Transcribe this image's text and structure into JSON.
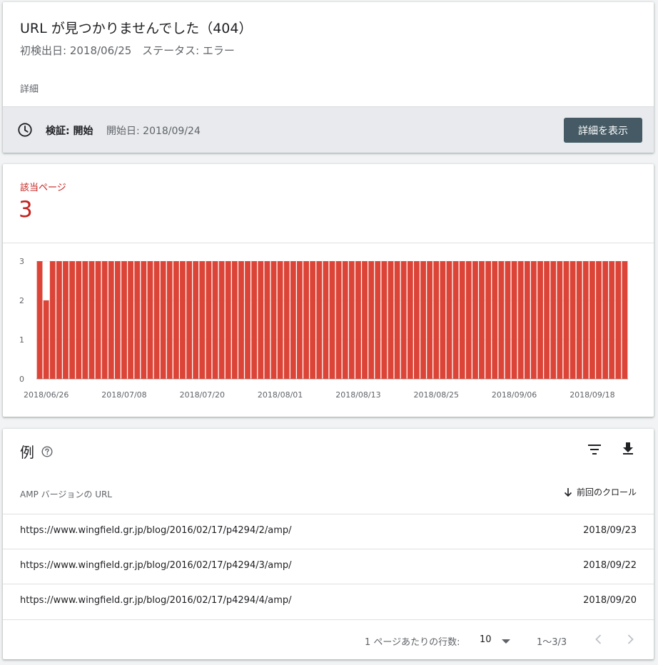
{
  "header": {
    "title": "URL が見つかりませんでした（404）",
    "first_detected": "初検出日: 2018/06/25",
    "status": "ステータス: エラー",
    "details_label": "詳細"
  },
  "validation": {
    "label": "検証: 開始",
    "start_date": "開始日: 2018/09/24",
    "button_label": "詳細を表示"
  },
  "affected": {
    "label": "該当ページ",
    "count": "3"
  },
  "colors": {
    "bar": "#db4437",
    "accent_text": "#c5221f",
    "button_bg": "#455a64"
  },
  "chart_data": {
    "type": "bar",
    "title": "",
    "xlabel": "",
    "ylabel": "",
    "ylim": [
      0,
      3
    ],
    "yticks": [
      "0",
      "1",
      "2",
      "3"
    ],
    "x_tick_labels": [
      "2018/06/26",
      "2018/07/08",
      "2018/07/20",
      "2018/08/01",
      "2018/08/13",
      "2018/08/25",
      "2018/09/06",
      "2018/09/18"
    ],
    "categories": [
      "2018/06/25",
      "2018/06/26",
      "2018/06/27",
      "2018/06/28",
      "2018/06/29",
      "2018/06/30",
      "2018/07/01",
      "2018/07/02",
      "2018/07/03",
      "2018/07/04",
      "2018/07/05",
      "2018/07/06",
      "2018/07/07",
      "2018/07/08",
      "2018/07/09",
      "2018/07/10",
      "2018/07/11",
      "2018/07/12",
      "2018/07/13",
      "2018/07/14",
      "2018/07/15",
      "2018/07/16",
      "2018/07/17",
      "2018/07/18",
      "2018/07/19",
      "2018/07/20",
      "2018/07/21",
      "2018/07/22",
      "2018/07/23",
      "2018/07/24",
      "2018/07/25",
      "2018/07/26",
      "2018/07/27",
      "2018/07/28",
      "2018/07/29",
      "2018/07/30",
      "2018/07/31",
      "2018/08/01",
      "2018/08/02",
      "2018/08/03",
      "2018/08/04",
      "2018/08/05",
      "2018/08/06",
      "2018/08/07",
      "2018/08/08",
      "2018/08/09",
      "2018/08/10",
      "2018/08/11",
      "2018/08/12",
      "2018/08/13",
      "2018/08/14",
      "2018/08/15",
      "2018/08/16",
      "2018/08/17",
      "2018/08/18",
      "2018/08/19",
      "2018/08/20",
      "2018/08/21",
      "2018/08/22",
      "2018/08/23",
      "2018/08/24",
      "2018/08/25",
      "2018/08/26",
      "2018/08/27",
      "2018/08/28",
      "2018/08/29",
      "2018/08/30",
      "2018/08/31",
      "2018/09/01",
      "2018/09/02",
      "2018/09/03",
      "2018/09/04",
      "2018/09/05",
      "2018/09/06",
      "2018/09/07",
      "2018/09/08",
      "2018/09/09",
      "2018/09/10",
      "2018/09/11",
      "2018/09/12",
      "2018/09/13",
      "2018/09/14",
      "2018/09/15",
      "2018/09/16",
      "2018/09/17",
      "2018/09/18",
      "2018/09/19",
      "2018/09/20",
      "2018/09/21",
      "2018/09/22",
      "2018/09/23"
    ],
    "values": [
      3,
      2,
      3,
      3,
      3,
      3,
      3,
      3,
      3,
      3,
      3,
      3,
      3,
      3,
      3,
      3,
      3,
      3,
      3,
      3,
      3,
      3,
      3,
      3,
      3,
      3,
      3,
      3,
      3,
      3,
      3,
      3,
      3,
      3,
      3,
      3,
      3,
      3,
      3,
      3,
      3,
      3,
      3,
      3,
      3,
      3,
      3,
      3,
      3,
      3,
      3,
      3,
      3,
      3,
      3,
      3,
      3,
      3,
      3,
      3,
      3,
      3,
      3,
      3,
      3,
      3,
      3,
      3,
      3,
      3,
      3,
      3,
      3,
      3,
      3,
      3,
      3,
      3,
      3,
      3,
      3,
      3,
      3,
      3,
      3,
      3,
      3,
      3,
      3,
      3,
      3
    ],
    "grid": true,
    "legend": "none"
  },
  "examples": {
    "title": "例",
    "col_url": "AMP バージョンの URL",
    "col_crawl": "前回のクロール",
    "rows": [
      {
        "url": "https://www.wingfield.gr.jp/blog/2016/02/17/p4294/2/amp/",
        "date": "2018/09/23"
      },
      {
        "url": "https://www.wingfield.gr.jp/blog/2016/02/17/p4294/3/amp/",
        "date": "2018/09/22"
      },
      {
        "url": "https://www.wingfield.gr.jp/blog/2016/02/17/p4294/4/amp/",
        "date": "2018/09/20"
      }
    ],
    "rows_per_page_label": "1 ページあたりの行数:",
    "rows_per_page_value": "10",
    "range": "1〜3/3"
  },
  "icons": {
    "clock": "clock-icon",
    "help": "help-circle-icon",
    "filter": "filter-icon",
    "download": "download-icon",
    "sort": "arrow-down-icon",
    "dropdown": "caret-down-icon",
    "prev": "chevron-left-icon",
    "next": "chevron-right-icon"
  }
}
